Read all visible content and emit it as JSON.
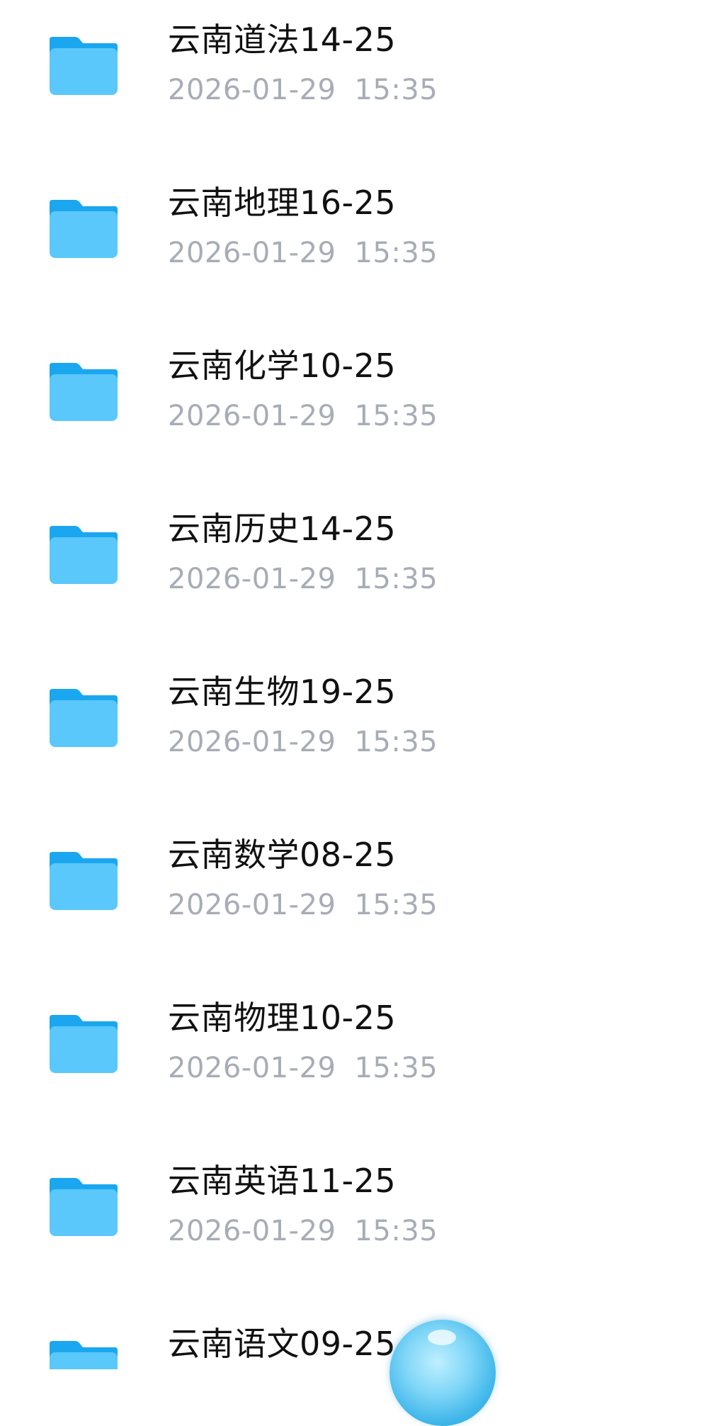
{
  "folders": [
    {
      "name": "云南道法14-25",
      "date": "2026-01-29",
      "time": "15:35"
    },
    {
      "name": "云南地理16-25",
      "date": "2026-01-29",
      "time": "15:35"
    },
    {
      "name": "云南化学10-25",
      "date": "2026-01-29",
      "time": "15:35"
    },
    {
      "name": "云南历史14-25",
      "date": "2026-01-29",
      "time": "15:35"
    },
    {
      "name": "云南生物19-25",
      "date": "2026-01-29",
      "time": "15:35"
    },
    {
      "name": "云南数学08-25",
      "date": "2026-01-29",
      "time": "15:35"
    },
    {
      "name": "云南物理10-25",
      "date": "2026-01-29",
      "time": "15:35"
    },
    {
      "name": "云南英语11-25",
      "date": "2026-01-29",
      "time": "15:35"
    },
    {
      "name": "云南语文09-25",
      "date": "",
      "time": ""
    }
  ],
  "icons": {
    "folder": "folder-icon",
    "floating_button": "assistant-ball-icon"
  },
  "colors": {
    "folder_front": "#5ac8fa",
    "folder_back": "#1aa7ef",
    "name_text": "#111111",
    "time_text": "#a7acb6",
    "background": "#ffffff"
  }
}
